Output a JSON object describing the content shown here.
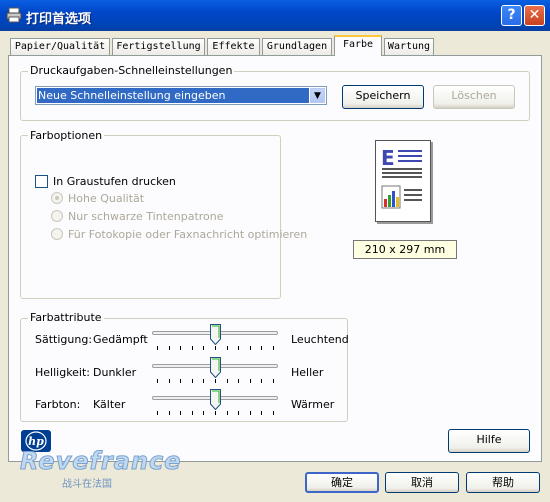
{
  "window": {
    "title": "打印首选项",
    "help_symbol": "?",
    "close_symbol": "✕"
  },
  "tabs": [
    {
      "label": "Papier/Qualität"
    },
    {
      "label": "Fertigstellung"
    },
    {
      "label": "Effekte"
    },
    {
      "label": "Grundlagen"
    },
    {
      "label": "Farbe"
    },
    {
      "label": "Wartung"
    }
  ],
  "quickset": {
    "group_label": "Druckaufgaben-Schnelleinstellungen",
    "select_value": "Neue Schnelleinstellung eingeben",
    "save_label": "Speichern",
    "delete_label": "Löschen"
  },
  "color_options": {
    "group_label": "Farboptionen",
    "grayscale_label": "In Graustufen drucken",
    "grayscale_checked": false,
    "radio_options": [
      "Hohe Qualität",
      "Nur schwarze Tintenpatrone",
      "Für Fotokopie oder Faxnachricht optimieren"
    ],
    "radio_selected": 0
  },
  "preview": {
    "paper_size": "210 x 297 mm"
  },
  "color_attributes": {
    "group_label": "Farbattribute",
    "sliders": [
      {
        "label": "Sättigung:",
        "left": "Gedämpft",
        "right": "Leuchtend",
        "value": 0.5
      },
      {
        "label": "Helligkeit:",
        "left": "Dunkler",
        "right": "Heller",
        "value": 0.5
      },
      {
        "label": "Farbton:",
        "left": "Kälter",
        "right": "Wärmer",
        "value": 0.5
      }
    ]
  },
  "help_label": "Hilfe",
  "logo_text": "hp",
  "watermark": {
    "text": "Revefrance",
    "subtext": "战斗在法国"
  },
  "footer": {
    "ok_label": "确定",
    "cancel_label": "取消",
    "help_label": "帮助"
  },
  "colors": {
    "titlebar": "#0047C8",
    "tab_highlight": "#FFC83C",
    "preview_label_bg": "#FFFFE1",
    "hp_blue": "#003E93"
  }
}
